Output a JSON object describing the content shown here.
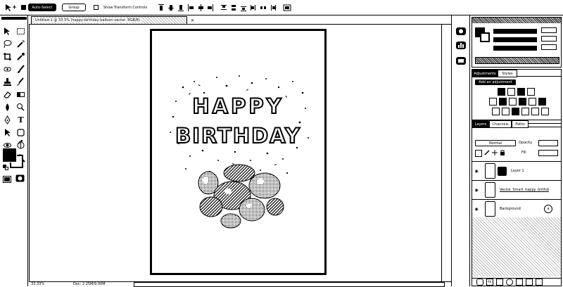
{
  "menubar": {
    "auto_select_label": "Auto-Select",
    "group_label": "Group",
    "show_transform_label": "Show Transform Controls"
  },
  "document_tab": {
    "label": "Untitled-1 @ 33.3% (happy-birthday-balloon-vector, RGB/8)"
  },
  "canvas": {
    "line1": "HAPPY",
    "line2": "BIRTHDAY"
  },
  "panels": {
    "adjustments_tab": "Adjustments",
    "styles_tab": "Styles",
    "add_adjustment_label": "Add an adjustment",
    "layers_tab": "Layers",
    "channels_tab": "Channels",
    "paths_tab": "Paths",
    "blend_mode": "Normal",
    "opacity_label": "Opacity",
    "fill_label": "Fill",
    "layers": [
      {
        "name": "Layer 1",
        "visible": true
      },
      {
        "name": "Vector_Smart_happy_birthday",
        "visible": true
      },
      {
        "name": "Background",
        "visible": true,
        "locked": true
      }
    ]
  },
  "statusbar": {
    "zoom": "33.33%",
    "doc_info": "Doc: 2.25M/9.00M"
  },
  "colors": {
    "foreground": "#000000",
    "background": "#ffffff"
  }
}
